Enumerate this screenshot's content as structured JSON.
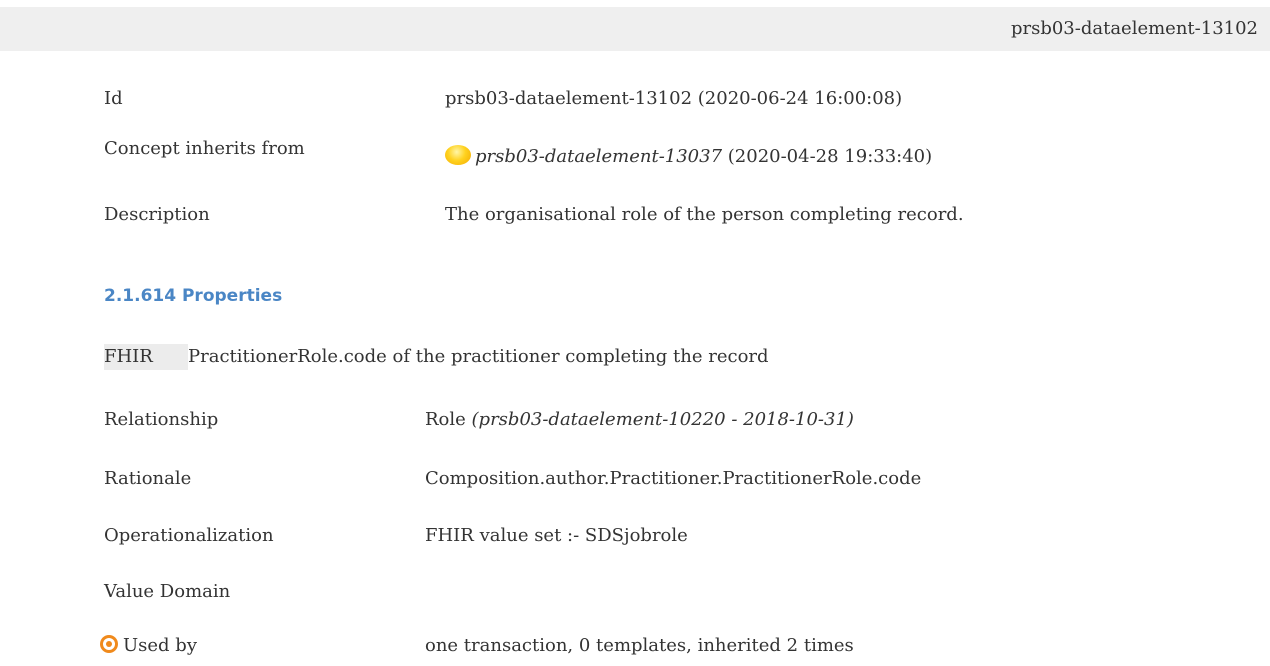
{
  "header": {
    "id": "prsb03-dataelement-13102"
  },
  "details": {
    "id_label": "Id",
    "id_value": "prsb03-dataelement-13102 (2020-06-24 16:00:08)",
    "concept_label": "Concept inherits from",
    "concept_link": "prsb03-dataelement-13037",
    "concept_date": " (2020-04-28 19:33:40)",
    "description_label": "Description",
    "description_value": "The organisational role of the person completing record."
  },
  "properties": {
    "heading": "2.1.614 Properties",
    "fhir_badge": "FHIR",
    "fhir_text": "PractitionerRole.code of the practitioner completing the record",
    "relationship_label": "Relationship",
    "relationship_value": "Role ",
    "relationship_ref": "(prsb03-dataelement-10220 - 2018-10-31)",
    "rationale_label": "Rationale",
    "rationale_value": "Composition.author.Practitioner.PractitionerRole.code",
    "operationalization_label": "Operationalization",
    "operationalization_value": "FHIR value set :- SDSjobrole",
    "value_domain_label": "Value Domain",
    "used_by_label": "Used by",
    "used_by_value": "one transaction, 0 templates, inherited 2 times"
  },
  "icons": {
    "concept_icon": "sun-icon",
    "used_by_icon": "target-icon"
  },
  "colors": {
    "heading": "#4a86c5",
    "header_bg": "#efefef",
    "sun": "#ffd21f",
    "target": "#f08a1c"
  }
}
